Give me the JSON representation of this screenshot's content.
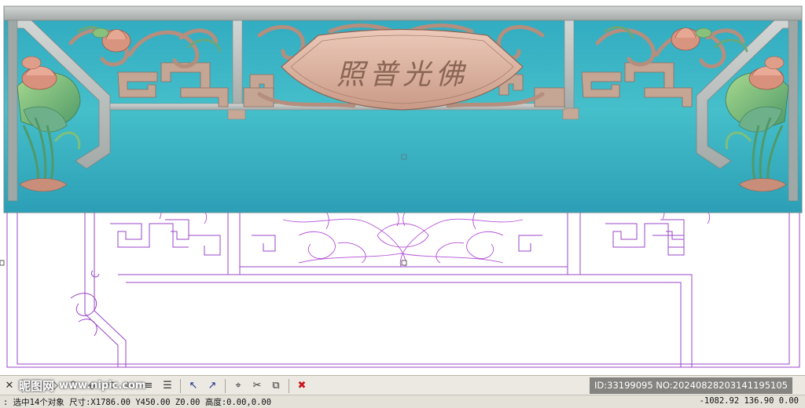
{
  "canvas": {
    "plaque_text": "照普光佛",
    "colors": {
      "background": "#ffffff",
      "relief_teal": "#3fb6c4",
      "frame_gray": "#b9bfbd",
      "plaque_pink": "#d8b1a2",
      "leaf_green": "#7fbf7a",
      "lotus_pink": "#d98a78",
      "vector_purple": "#a23fd0",
      "outline_purple": "#8a3da8"
    }
  },
  "toolbar": {
    "tools": [
      {
        "name": "close-panel-icon",
        "glyph": "✕"
      },
      {
        "name": "rect-select-icon",
        "glyph": "▢"
      },
      {
        "name": "node-edit-icon",
        "glyph": "◇"
      },
      {
        "name": "polygon-icon",
        "glyph": "⬡"
      },
      {
        "name": "offset-icon",
        "glyph": "◈"
      },
      {
        "name": "rotate-icon",
        "glyph": "⟲"
      },
      {
        "name": "mirror-icon",
        "glyph": "⇋"
      },
      {
        "name": "align-icon",
        "glyph": "≡"
      },
      {
        "name": "layers-icon",
        "glyph": "☰"
      },
      {
        "name": "pick-icon",
        "glyph": "↖"
      },
      {
        "name": "unpick-icon",
        "glyph": "↗"
      },
      {
        "name": "snap-icon",
        "glyph": "⌖"
      },
      {
        "name": "trim-icon",
        "glyph": "✂"
      },
      {
        "name": "join-icon",
        "glyph": "⧉"
      },
      {
        "name": "delete-icon",
        "glyph": "✖"
      }
    ]
  },
  "watermark": {
    "logo": "昵图网",
    "site": "www.nipic.com",
    "id_text": "ID:33199095 NO:20240828203141195105"
  },
  "status": {
    "left": ": 选中14个对象 尺寸:X1786.00 Y450.00 Z0.00 高度:0.00,0.00",
    "right": "-1082.92 136.90 0.00"
  }
}
